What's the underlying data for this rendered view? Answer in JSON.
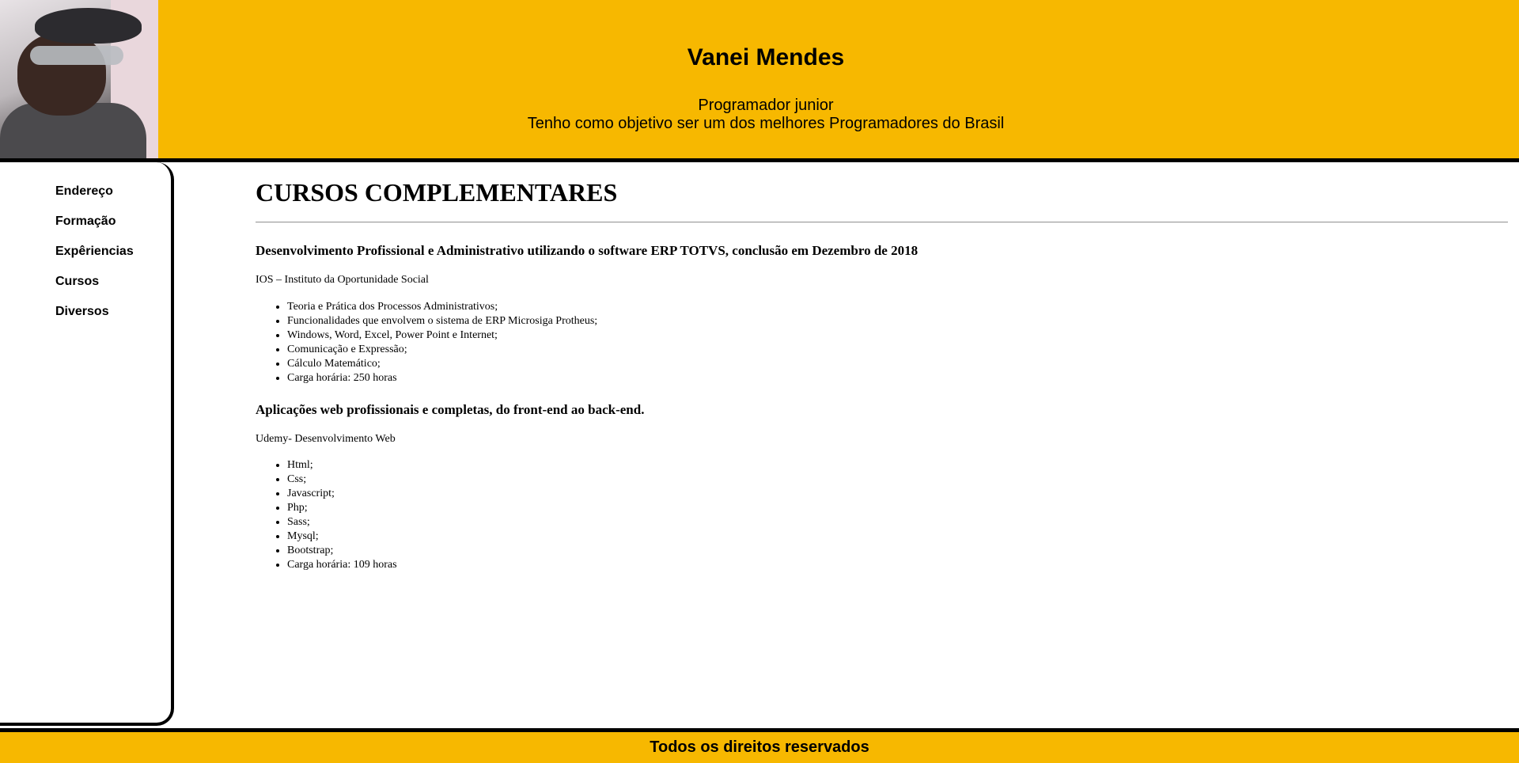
{
  "header": {
    "name": "Vanei Mendes",
    "role": "Programador junior",
    "goal": "Tenho como objetivo ser um dos melhores Programadores do Brasil"
  },
  "sidebar": {
    "items": [
      {
        "label": "Endereço"
      },
      {
        "label": "Formação"
      },
      {
        "label": "Expêriencias"
      },
      {
        "label": "Cursos"
      },
      {
        "label": "Diversos"
      }
    ]
  },
  "main": {
    "title": "CURSOS COMPLEMENTARES",
    "courses": [
      {
        "title": "Desenvolvimento Profissional e Administrativo utilizando o software ERP TOTVS, conclusão em Dezembro de 2018",
        "institution": "IOS – Instituto da Oportunidade Social",
        "items": [
          "Teoria e Prática dos Processos Administrativos;",
          "Funcionalidades que envolvem o sistema de ERP Microsiga Protheus;",
          "Windows, Word, Excel, Power Point e Internet;",
          "Comunicação e Expressão;",
          "Cálculo Matemático;",
          "Carga horária: 250 horas"
        ]
      },
      {
        "title": "Aplicações web profissionais e completas, do front-end ao back-end.",
        "institution": "Udemy- Desenvolvimento Web",
        "items": [
          "Html;",
          "Css;",
          "Javascript;",
          "Php;",
          "Sass;",
          "Mysql;",
          "Bootstrap;",
          "Carga horária: 109 horas"
        ]
      }
    ]
  },
  "footer": {
    "text": "Todos os direitos reservados"
  }
}
